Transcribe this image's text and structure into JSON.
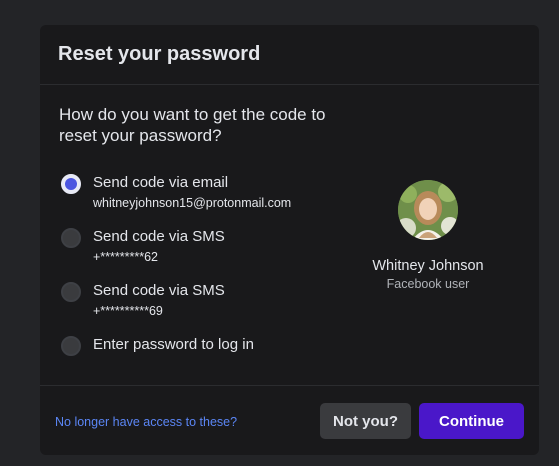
{
  "dialog": {
    "title": "Reset your password",
    "question": "How do you want to get the code to reset your password?",
    "options": [
      {
        "label": "Send code via email",
        "detail": "whitneyjohnson15@protonmail.com",
        "selected": true
      },
      {
        "label": "Send code via SMS",
        "detail": "+*********62",
        "selected": false
      },
      {
        "label": "Send code via SMS",
        "detail": "+**********69",
        "selected": false
      },
      {
        "label": "Enter password to log in",
        "detail": "",
        "selected": false
      }
    ],
    "profile": {
      "name": "Whitney Johnson",
      "subtitle": "Facebook user"
    },
    "footer": {
      "link_label": "No longer have access to these?",
      "not_you_label": "Not you?",
      "continue_label": "Continue"
    }
  },
  "colors": {
    "background": "#232427",
    "panel": "#19191b",
    "primary_button": "#4a17c9",
    "link": "#5b86f5",
    "radio_selected": "#4b55e0"
  },
  "icons": {
    "avatar": "profile-photo"
  }
}
